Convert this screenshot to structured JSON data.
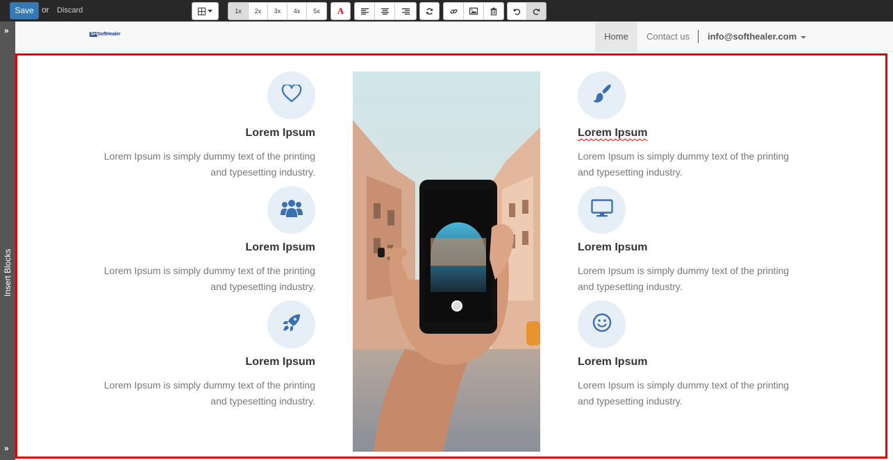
{
  "editor": {
    "save_label": "Save",
    "or_label": "or",
    "discard_label": "Discard",
    "size_buttons": [
      "1x",
      "2x",
      "3x",
      "4x",
      "5x"
    ],
    "active_size": "1x"
  },
  "sidebar": {
    "insert_blocks_label": "Insert Blocks"
  },
  "navbar": {
    "logo_mark": "SH",
    "logo_text": "SoftHealer",
    "home_label": "Home",
    "contact_label": "Contact us",
    "email_label": "info@softhealer.com"
  },
  "features": {
    "left": [
      {
        "icon": "heart-icon",
        "title": "Lorem Ipsum",
        "desc": "Lorem Ipsum is simply dummy text of the printing and typesetting industry."
      },
      {
        "icon": "users-icon",
        "title": "Lorem Ipsum",
        "desc": "Lorem Ipsum is simply dummy text of the printing and typesetting industry."
      },
      {
        "icon": "rocket-icon",
        "title": "Lorem Ipsum",
        "desc": "Lorem Ipsum is simply dummy text of the printing and typesetting industry."
      }
    ],
    "right": [
      {
        "icon": "paintbrush-icon",
        "title": "Lorem Ipsum",
        "desc": "Lorem Ipsum is simply dummy text of the printing and typesetting industry."
      },
      {
        "icon": "desktop-icon",
        "title": "Lorem Ipsum",
        "desc": "Lorem Ipsum is simply dummy text of the printing and typesetting industry."
      },
      {
        "icon": "smile-icon",
        "title": "Lorem Ipsum",
        "desc": "Lorem Ipsum is simply dummy text of the printing and typesetting industry."
      }
    ]
  },
  "colors": {
    "accent": "#337ab7",
    "icon_blue": "#3a6fb0",
    "icon_bg": "#e6eef7",
    "selection_border": "#e00000",
    "editor_bar": "#282828"
  }
}
